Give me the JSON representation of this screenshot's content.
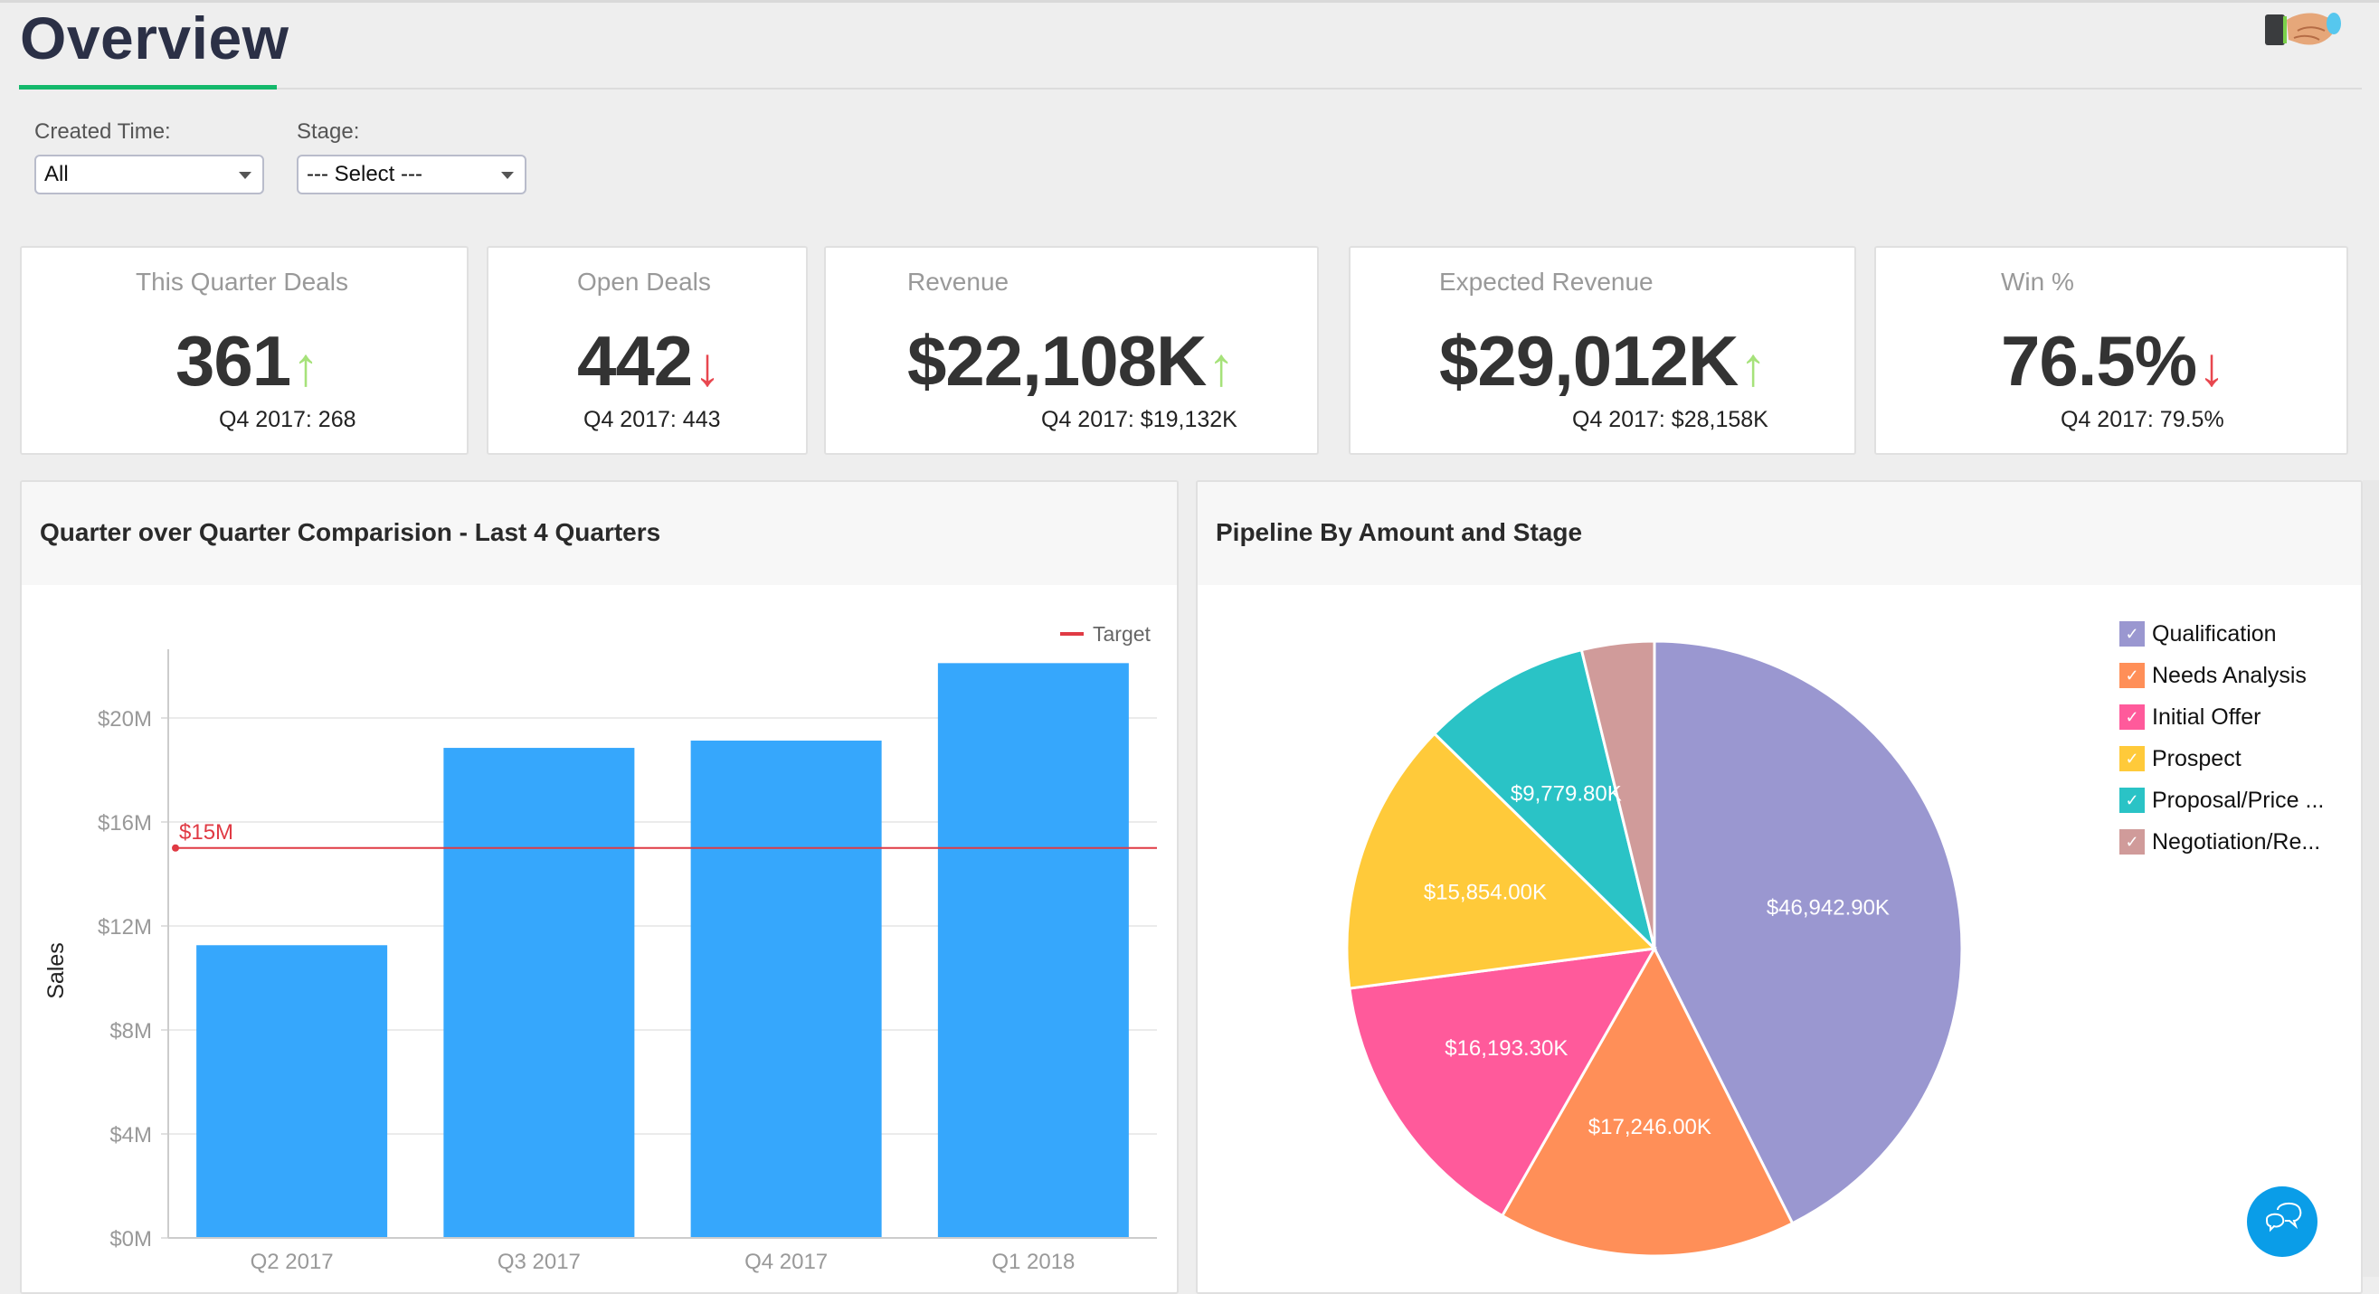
{
  "header": {
    "title": "Overview",
    "logo_icon": "handshake-icon"
  },
  "filters": {
    "created_time": {
      "label": "Created Time:",
      "value": "All"
    },
    "stage": {
      "label": "Stage:",
      "value": "--- Select ---"
    }
  },
  "kpis": [
    {
      "title": "This Quarter Deals",
      "value": "361",
      "trend": "up",
      "arrow": "↑",
      "previous": "Q4 2017: 268"
    },
    {
      "title": "Open Deals",
      "value": "442",
      "trend": "down",
      "arrow": "↓",
      "previous": "Q4 2017: 443"
    },
    {
      "title": "Revenue",
      "value": "$22,108K",
      "trend": "up",
      "arrow": "↑",
      "previous": "Q4 2017: $19,132K"
    },
    {
      "title": "Expected Revenue",
      "value": "$29,012K",
      "trend": "up",
      "arrow": "↑",
      "previous": "Q4 2017: $28,158K"
    },
    {
      "title": "Win %",
      "value": "76.5%",
      "trend": "down",
      "arrow": "↓",
      "previous": "Q4 2017: 79.5%"
    }
  ],
  "colors": {
    "trend_up": "#a6e27a",
    "trend_down": "#e8474f",
    "bar": "#36a7fc",
    "target": "#e03a44",
    "accent": "#13b86b",
    "chat": "#0a9de8"
  },
  "chat_button": {
    "icon": "chat-bubbles-icon"
  },
  "chart_data": [
    {
      "type": "bar",
      "title": "Quarter over Quarter Comparision - Last 4 Quarters",
      "categories": [
        "Q2 2017",
        "Q3 2017",
        "Q4 2017",
        "Q1 2018"
      ],
      "series": [
        {
          "name": "Sales",
          "values": [
            11.26,
            18.85,
            19.13,
            22.11
          ],
          "unit": "$M"
        }
      ],
      "reference_lines": [
        {
          "name": "Target",
          "value": 15,
          "label": "$15M"
        }
      ],
      "xlabel": "",
      "ylabel": "Sales",
      "ylim": [
        0,
        24
      ],
      "yticks": [
        0,
        4,
        8,
        12,
        16,
        20
      ],
      "ytick_labels": [
        "$0M",
        "$4M",
        "$8M",
        "$12M",
        "$16M",
        "$20M"
      ],
      "grid": true,
      "legend": {
        "position": "top-right",
        "entries": [
          "Target"
        ]
      }
    },
    {
      "type": "pie",
      "title": "Pipeline By Amount and Stage",
      "start": "top-clockwise",
      "slices": [
        {
          "label": "Qualification",
          "legend_label": "Qualification",
          "value": 46942.9,
          "value_label": "$46,942.90K",
          "color": "#9a97d0"
        },
        {
          "label": "Needs Analysis",
          "legend_label": "Needs Analysis",
          "value": 17246.0,
          "value_label": "$17,246.00K",
          "color": "#ff8f58"
        },
        {
          "label": "Initial Offer",
          "legend_label": "Initial Offer",
          "value": 16193.3,
          "value_label": "$16,193.30K",
          "color": "#ff5a9b"
        },
        {
          "label": "Prospect",
          "legend_label": "Prospect",
          "value": 15854.0,
          "value_label": "$15,854.00K",
          "color": "#ffca3a"
        },
        {
          "label": "Proposal/Price Quote",
          "legend_label": "Proposal/Price ...",
          "value": 9779.8,
          "value_label": "$9,779.80K",
          "color": "#2ac3c6"
        },
        {
          "label": "Negotiation/Review",
          "legend_label": "Negotiation/Re...",
          "value": 4200,
          "value_label": "",
          "color": "#d09b9a"
        }
      ],
      "legend": {
        "position": "right",
        "checked": true
      }
    }
  ]
}
